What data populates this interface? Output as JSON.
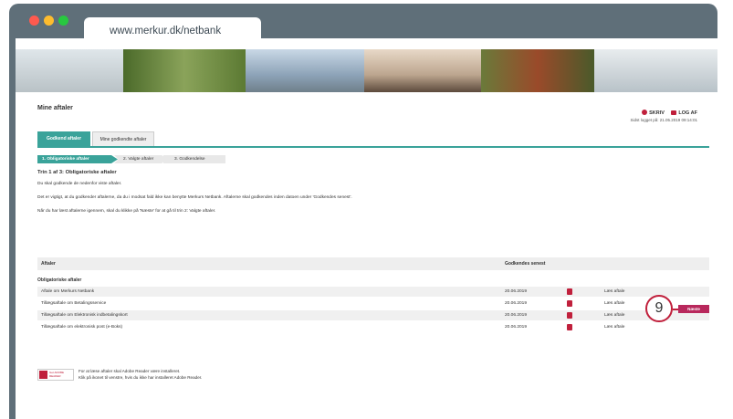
{
  "browser": {
    "url": "www.merkur.dk/netbank",
    "traffic_light_colors": [
      "#ff5f57",
      "#febc2e",
      "#28c840"
    ]
  },
  "page": {
    "title": "Mine aftaler",
    "top_links": {
      "write": "SKRIV",
      "logout": "LOG AF"
    },
    "login_time": "Sidst logget på: 21.05.2019 09:14:01"
  },
  "tabs": [
    "Godkend aftaler",
    "Mine godkendte aftaler"
  ],
  "steps": [
    "1. Obligatoriske aftaler",
    "2. Valgte aftaler",
    "3. Godkendelse"
  ],
  "step_title": "Trin 1 af 3: Obligatoriske aftaler",
  "paragraphs": [
    "Du skal godkende de nedenfor viste aftaler.",
    "Det er vigtigt, at du godkender aftalerne, da du i modsat fald ikke kan benytte Merkurs Netbank. Aftalerne skal godkendes inden datoen under 'Godkendes senest'.",
    "Når du har læst aftalerne igennem, skal du klikke på 'Næste' for at gå til trin 2: Valgte aftaler."
  ],
  "table": {
    "headers": [
      "Aftaler",
      "Godkendes senest"
    ],
    "group": "Obligatoriske aftaler",
    "rows": [
      {
        "name": "Aftale om Merkurs Netbank",
        "date": "20.06.2019",
        "action": "Læs aftale"
      },
      {
        "name": "Tillægsaftale om Betalingsservice",
        "date": "20.06.2019",
        "action": "Læs aftale"
      },
      {
        "name": "Tillægsaftale om Elektronisk indbetalingskort",
        "date": "20.06.2019",
        "action": "Læs aftale"
      },
      {
        "name": "Tillægsaftale om elektronisk post (e-Boks)",
        "date": "20.06.2019",
        "action": "Læs aftale"
      }
    ]
  },
  "callout_number": "9",
  "next_button": "Næste",
  "adobe": {
    "logo_text": "Get ADOBE READER",
    "lines": [
      "For at læse aftaler skal Adobe Reader være installeret.",
      "Klik på ikonet til venstre, hvis du ikke har installeret Adobe Reader."
    ]
  },
  "colors": {
    "accent": "#3aa39a",
    "brand_red": "#c0203c",
    "next_button": "#b8285c",
    "frame": "#5f6f79"
  }
}
